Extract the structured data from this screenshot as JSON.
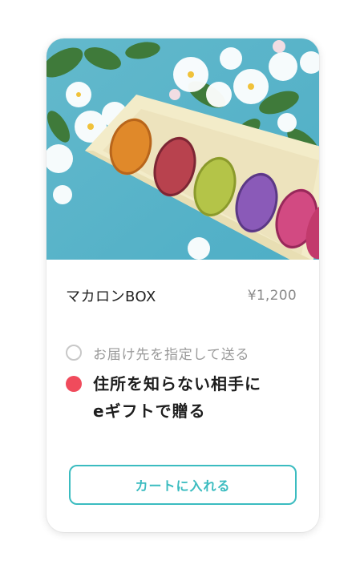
{
  "product": {
    "image_alt": "macaron-box-photo",
    "name": "マカロンBOX",
    "price": "¥1,200"
  },
  "delivery_options": [
    {
      "label": "お届け先を指定して送る",
      "selected": false
    },
    {
      "label_line1": "住所を知らない相手に",
      "label_line2": "eギフトで贈る",
      "selected": true
    }
  ],
  "cart_button": {
    "label": "カートに入れる"
  },
  "colors": {
    "accent": "#3bbcc0",
    "selected_radio": "#f04b5c",
    "background_photo": "#5fb7c9"
  }
}
